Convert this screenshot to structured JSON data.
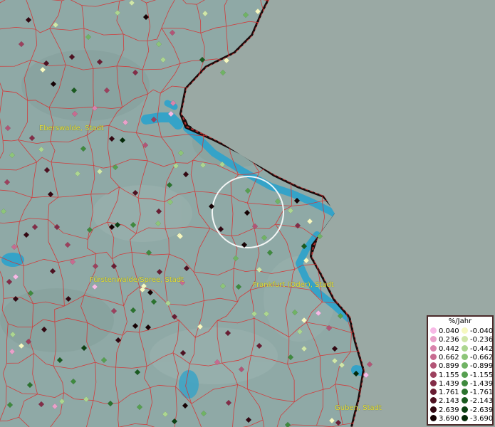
{
  "map": {
    "cities": [
      {
        "name": "Eberswalde, Stadt"
      },
      {
        "name": "Fürstenwalde/Spree, Stadt"
      },
      {
        "name": "Frankfurt (Oder), Stadt"
      },
      {
        "name": "Guben, Stadt"
      }
    ],
    "colors": {
      "land": "#8fa9a6",
      "land_east": "#9aa9a4",
      "water": "#35a3c8",
      "borders": "#d83030",
      "city_label": "#e8e23a"
    }
  },
  "legend": {
    "title": "%/Jahr",
    "positive": [
      {
        "label": "0.040",
        "color": "#f7b9e6"
      },
      {
        "label": "0.236",
        "color": "#e9a0c9"
      },
      {
        "label": "0.442",
        "color": "#d983ac"
      },
      {
        "label": "0.662",
        "color": "#c76b90"
      },
      {
        "label": "0.899",
        "color": "#b25576"
      },
      {
        "label": "1.155",
        "color": "#9c415e"
      },
      {
        "label": "1.439",
        "color": "#832d48"
      },
      {
        "label": "1.761",
        "color": "#691d33"
      },
      {
        "label": "2.143",
        "color": "#4e1121"
      },
      {
        "label": "2.639",
        "color": "#330812"
      },
      {
        "label": "3.690",
        "color": "#160204"
      }
    ],
    "negative": [
      {
        "label": "-0.040",
        "color": "#f6f8c0"
      },
      {
        "label": "-0.236",
        "color": "#cfe6a8"
      },
      {
        "label": "-0.442",
        "color": "#acd690"
      },
      {
        "label": "-0.662",
        "color": "#8dc579"
      },
      {
        "label": "-0.899",
        "color": "#70b364"
      },
      {
        "label": "-1.155",
        "color": "#569f50"
      },
      {
        "label": "-1.439",
        "color": "#3f8a3e"
      },
      {
        "label": "-1.761",
        "color": "#2b732e"
      },
      {
        "label": "-2.143",
        "color": "#1a5b20"
      },
      {
        "label": "-2.639",
        "color": "#0d4314"
      },
      {
        "label": "-3.690",
        "color": "#042a08"
      }
    ]
  }
}
